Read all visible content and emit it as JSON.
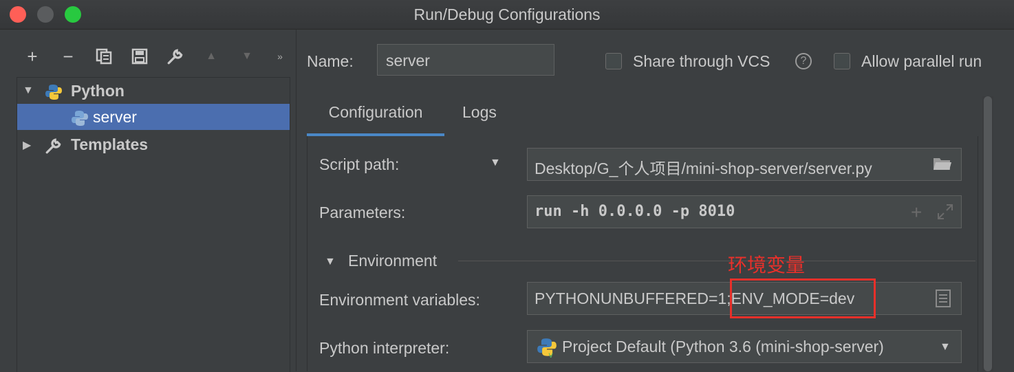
{
  "window": {
    "title": "Run/Debug Configurations"
  },
  "sidebar": {
    "tree": [
      {
        "label": "Python",
        "expanded": true
      },
      {
        "label": "server",
        "selected": true
      },
      {
        "label": "Templates",
        "expanded": false
      }
    ]
  },
  "header": {
    "name_label": "Name:",
    "name_value": "server",
    "share_vcs": "Share through VCS",
    "help": "?",
    "allow_parallel": "Allow parallel run"
  },
  "tabs": [
    {
      "label": "Configuration",
      "active": true
    },
    {
      "label": "Logs",
      "active": false
    }
  ],
  "config": {
    "script_path_label": "Script path:",
    "script_path_value": "Desktop/G_个人项目/mini-shop-server/server.py",
    "parameters_label": "Parameters:",
    "parameters_value": "run -h 0.0.0.0 -p 8010",
    "environment_section": "Environment",
    "env_vars_label": "Environment variables:",
    "env_vars_value": "PYTHONUNBUFFERED=1;ENV_MODE=dev",
    "interpreter_label": "Python interpreter:",
    "interpreter_value": "Project Default (Python 3.6 (mini-shop-server)"
  },
  "annotation": {
    "text": "环境变量",
    "color": "#e8302a"
  },
  "colors": {
    "accent": "#4a88c7",
    "selection": "#4b6eaf"
  }
}
